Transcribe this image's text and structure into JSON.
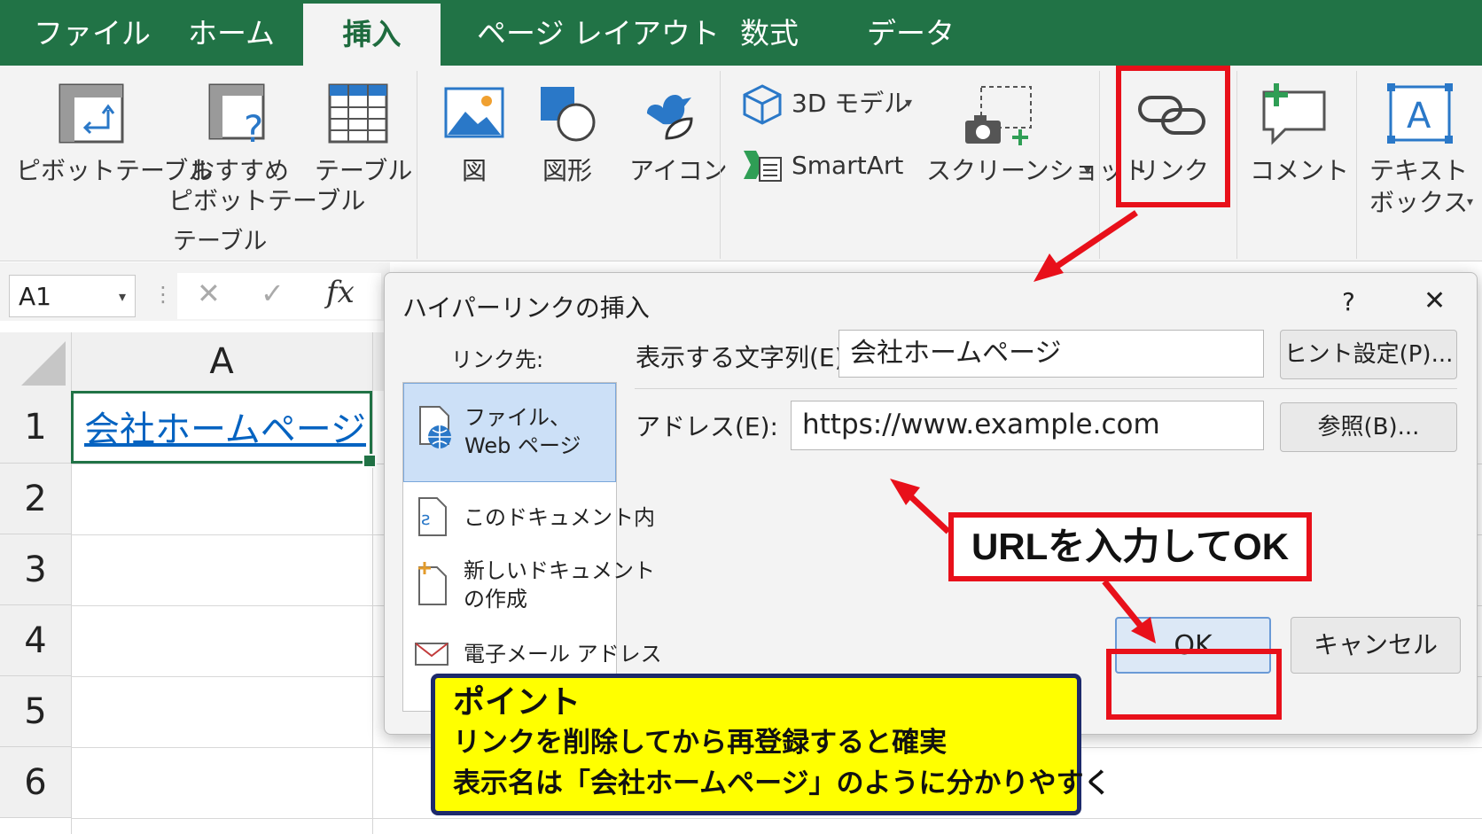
{
  "tabs": [
    "ファイル",
    "ホーム",
    "挿入",
    "ページ レイアウト",
    "数式",
    "データ"
  ],
  "active_tab": "挿入",
  "ribbon": {
    "pivot_table": "ピボットテーブル",
    "recommended_pivot_line1": "おすすめ",
    "recommended_pivot_line2": "ピボットテーブル",
    "table": "テーブル",
    "group_table": "テーブル",
    "picture": "図",
    "shapes": "図形",
    "icons": "アイコン",
    "model3d": "3D モデル",
    "smartart": "SmartArt",
    "screenshot": "スクリーンショット",
    "link": "リンク",
    "comment": "コメント",
    "textbox_line1": "テキスト",
    "textbox_line2": "ボックス"
  },
  "formula_bar": {
    "name_box": "A1",
    "fx": "fx"
  },
  "sheet": {
    "column": "A",
    "rows": [
      "1",
      "2",
      "3",
      "4",
      "5",
      "6"
    ],
    "cell_a1": "会社ホームページ"
  },
  "dialog": {
    "title": "ハイパーリンクの挿入",
    "help": "?",
    "close": "✕",
    "link_target_label": "リンク先:",
    "nav": {
      "file_web_line1": "ファイル、",
      "file_web_line2": "Web ページ",
      "this_doc": "このドキュメント内",
      "new_doc_line1": "新しいドキュメント",
      "new_doc_line2": "の作成",
      "email": "電子メール アドレス"
    },
    "display_text_label": "表示する文字列(E):",
    "display_text_value": "会社ホームページ",
    "screentip_button": "ヒント設定(P)...",
    "address_label": "アドレス(E):",
    "address_value": "https://www.example.com",
    "browse_button": "参照(B)...",
    "ok_button": "OK",
    "cancel_button": "キャンセル"
  },
  "annotations": {
    "callout": "URLを入力してOK",
    "point_title": "ポイント",
    "point_line1": "リンクを削除してから再登録すると確実",
    "point_line2": "表示名は「会社ホームページ」のように分かりやすく"
  },
  "colors": {
    "excel_green": "#217346",
    "annotation_red": "#e8101a",
    "hyperlink_blue": "#0563c1",
    "point_yellow": "#ffff00",
    "selection_blue": "#cce0f7"
  }
}
